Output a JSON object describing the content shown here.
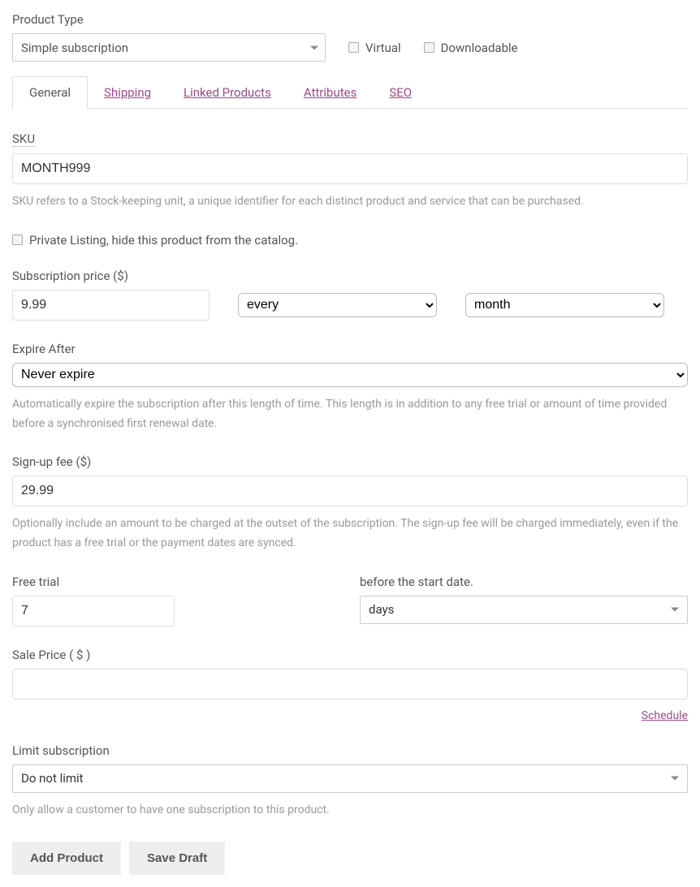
{
  "productType": {
    "label": "Product Type",
    "value": "Simple subscription"
  },
  "virtual": {
    "label": "Virtual"
  },
  "downloadable": {
    "label": "Downloadable"
  },
  "tabs": {
    "general": "General",
    "shipping": "Shipping",
    "linked": "Linked Products",
    "attributes": "Attributes",
    "seo": "SEO"
  },
  "sku": {
    "label": "SKU",
    "value": "MONTH999",
    "help": "SKU refers to a Stock-keeping unit, a unique identifier for each distinct product and service that can be purchased."
  },
  "private": {
    "label": "Private Listing, hide this product from the catalog."
  },
  "subPrice": {
    "label": "Subscription price ($)",
    "value": "9.99",
    "interval": "every",
    "period": "month"
  },
  "expire": {
    "label": "Expire After",
    "value": "Never expire",
    "help": "Automatically expire the subscription after this length of time. This length is in addition to any free trial or amount of time provided before a synchronised first renewal date."
  },
  "signup": {
    "label": "Sign-up fee ($)",
    "value": "29.99",
    "help": "Optionally include an amount to be charged at the outset of the subscription. The sign-up fee will be charged immediately, even if the product has a free trial or the payment dates are synced."
  },
  "trial": {
    "label": "Free trial",
    "value": "7",
    "beforeLabel": "before the start date.",
    "unit": "days"
  },
  "salePrice": {
    "label": "Sale Price ( $ )",
    "value": "",
    "schedule": "Schedule"
  },
  "limit": {
    "label": "Limit subscription",
    "value": "Do not limit",
    "help": "Only allow a customer to have one subscription to this product."
  },
  "buttons": {
    "add": "Add Product",
    "draft": "Save Draft"
  }
}
